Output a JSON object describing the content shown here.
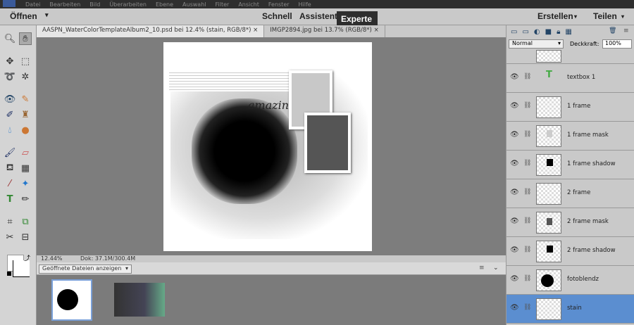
{
  "menu": [
    "Datei",
    "Bearbeiten",
    "Bild",
    "Überarbeiten",
    "Ebene",
    "Auswahl",
    "Filter",
    "Ansicht",
    "Fenster",
    "Hilfe"
  ],
  "modebar": {
    "open": "Öffnen",
    "quick": "Schnell",
    "guided": "Assistent",
    "expert": "Experte",
    "create": "Erstellen",
    "share": "Teilen"
  },
  "tabs": [
    {
      "label": "AASPN_WaterColorTemplateAlbum2_10.psd bei 12.4% (stain, RGB/8*)"
    },
    {
      "label": "IMGP2894.jpg bei 13.7% (RGB/8*)"
    }
  ],
  "close": "×",
  "doc_text": "amazing",
  "status": {
    "zoom": "12.44%",
    "doc": "Dok: 37.1M/300.4M"
  },
  "bin": {
    "dropdown": "Geöffnete Dateien anzeigen"
  },
  "layers_panel": {
    "blend_mode": "Normal",
    "opacity_label": "Deckkraft:",
    "opacity": "100%"
  },
  "layers": [
    {
      "name": "textbox 1"
    },
    {
      "name": "1 frame"
    },
    {
      "name": "1 frame mask"
    },
    {
      "name": "1 frame shadow"
    },
    {
      "name": "2 frame"
    },
    {
      "name": "2 frame mask"
    },
    {
      "name": "2 frame shadow"
    },
    {
      "name": "fotoblendz"
    },
    {
      "name": "stain"
    }
  ]
}
